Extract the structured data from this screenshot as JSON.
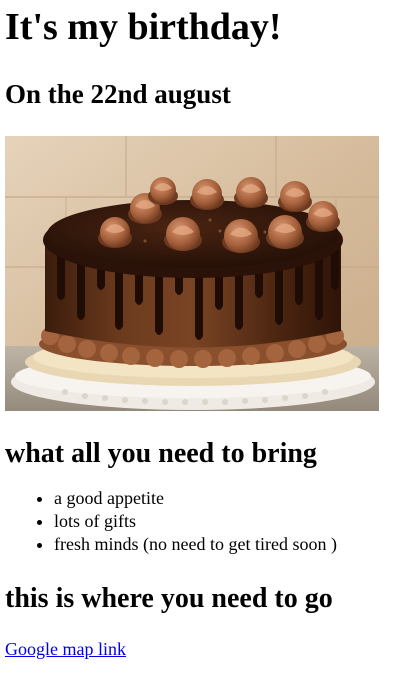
{
  "page": {
    "title": "It's my birthday!",
    "date_heading": "On the 22nd august",
    "image": {
      "subject": "chocolate-drip-cake",
      "colors": {
        "wall": "#d8c2a6",
        "chocolate": "#3a1b0c",
        "frosting": "#a8623d",
        "stand": "#ece8e2"
      }
    },
    "bring_heading": "what all you need to bring",
    "bring_items": [
      "a good appetite",
      "lots of gifts",
      "fresh minds (no need to get tired soon )"
    ],
    "location_heading": "this is where you need to go",
    "map_link_label": "Google map link",
    "link_color": "#0000ee"
  }
}
